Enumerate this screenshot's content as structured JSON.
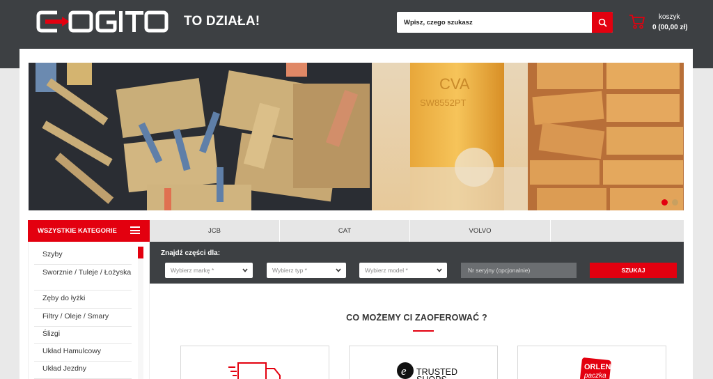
{
  "header": {
    "logo_text": "COGITO",
    "slogan": "TO DZIAŁA!",
    "search_placeholder": "Wpisz, czego szukasz",
    "cart": {
      "label": "koszyk",
      "total": "0 (00,00 zł)"
    }
  },
  "banner": {
    "images": [
      "bucket-teeth-assortment",
      "worn-tooth-cva",
      "stacked-teeth"
    ],
    "stamp_lines": [
      "CVA",
      "SW8552PT"
    ]
  },
  "categories": {
    "header_label": "WSZYSTKIE KATEGORIE",
    "items": [
      "Szyby",
      "Sworznie / Tuleje / Łożyska",
      "Zęby do łyżki",
      "Filtry / Oleje / Smary",
      "Ślizgi",
      "Układ Hamulcowy",
      "Układ Jezdny"
    ]
  },
  "brand_tabs": [
    "JCB",
    "CAT",
    "VOLVO",
    ""
  ],
  "finder": {
    "label": "Znajdź części dla:",
    "selects": [
      "Wybierz markę *",
      "Wybierz typ *",
      "Wybierz model *"
    ],
    "serial_placeholder": "Nr seryjny (opcjonalnie)",
    "button_label": "SZUKAJ"
  },
  "offer": {
    "title": "CO MOŻEMY CI ZAOFEROWAĆ ?",
    "cards": [
      {
        "icon": "delivery-truck-icon"
      },
      {
        "icon": "trusted-shops-logo",
        "text": "TRUSTED SHOPS"
      },
      {
        "icon": "orlen-paczka-logo",
        "text": "ORLEN paczka"
      }
    ]
  },
  "colors": {
    "accent": "#e3000f",
    "dark": "#3d4043"
  }
}
